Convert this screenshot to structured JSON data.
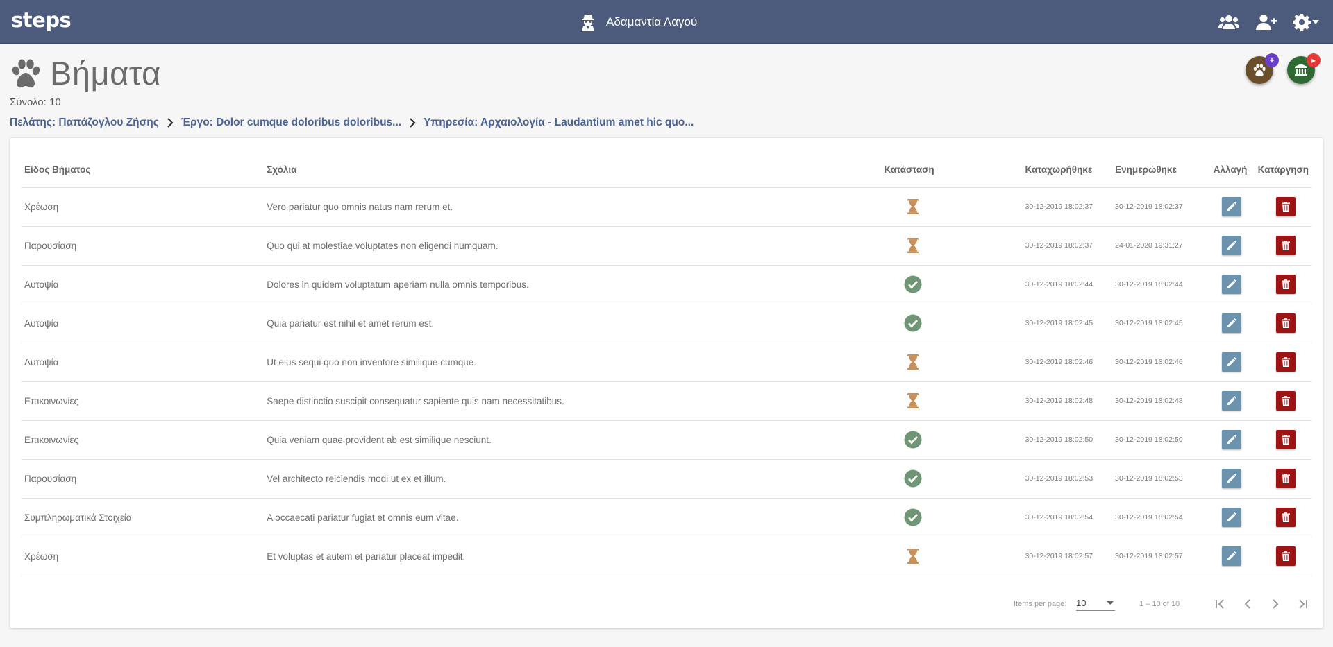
{
  "app": {
    "brand": "steps"
  },
  "header": {
    "user_name": "Αδαμαντία Λαγού",
    "icons": [
      "users-icon",
      "add-user-icon",
      "gear-icon"
    ]
  },
  "page": {
    "title": "Βήματα",
    "total_label": "Σύνολο: 10"
  },
  "breadcrumb": {
    "client": "Πελάτης: Παπάζογλου Ζήσης",
    "project": "Έργο: Dolor cumque doloribus doloribus...",
    "service": "Υπηρεσία: Αρχαιολογία - Laudantium amet hic quo..."
  },
  "fabs": {
    "steps_badge": "+",
    "service_badge": "▸"
  },
  "table": {
    "headers": {
      "type": "Είδος Βήματος",
      "comments": "Σχόλια",
      "status": "Κατάσταση",
      "created": "Καταχωρήθηκε",
      "updated": "Ενημερώθηκε",
      "edit": "Αλλαγή",
      "delete": "Κατάργηση"
    },
    "rows": [
      {
        "type": "Χρέωση",
        "comments": "Vero pariatur quo omnis natus nam rerum et.",
        "status": "pending",
        "created": "30-12-2019 18:02:37",
        "updated": "30-12-2019 18:02:37"
      },
      {
        "type": "Παρουσίαση",
        "comments": "Quo qui at molestiae voluptates non eligendi numquam.",
        "status": "pending",
        "created": "30-12-2019 18:02:37",
        "updated": "24-01-2020 19:31:27"
      },
      {
        "type": "Αυτοψία",
        "comments": "Dolores in quidem voluptatum aperiam nulla omnis temporibus.",
        "status": "done",
        "created": "30-12-2019 18:02:44",
        "updated": "30-12-2019 18:02:44"
      },
      {
        "type": "Αυτοψία",
        "comments": "Quia pariatur est nihil et amet rerum est.",
        "status": "done",
        "created": "30-12-2019 18:02:45",
        "updated": "30-12-2019 18:02:45"
      },
      {
        "type": "Αυτοψία",
        "comments": "Ut eius sequi quo non inventore similique cumque.",
        "status": "pending",
        "created": "30-12-2019 18:02:46",
        "updated": "30-12-2019 18:02:46"
      },
      {
        "type": "Επικοινωνίες",
        "comments": "Saepe distinctio suscipit consequatur sapiente quis nam necessitatibus.",
        "status": "pending",
        "created": "30-12-2019 18:02:48",
        "updated": "30-12-2019 18:02:48"
      },
      {
        "type": "Επικοινωνίες",
        "comments": "Quia veniam quae provident ab est similique nesciunt.",
        "status": "done",
        "created": "30-12-2019 18:02:50",
        "updated": "30-12-2019 18:02:50"
      },
      {
        "type": "Παρουσίαση",
        "comments": "Vel architecto reiciendis modi ut ex et illum.",
        "status": "done",
        "created": "30-12-2019 18:02:53",
        "updated": "30-12-2019 18:02:53"
      },
      {
        "type": "Συμπληρωματικά Στοιχεία",
        "comments": "A occaecati pariatur fugiat et omnis eum vitae.",
        "status": "done",
        "created": "30-12-2019 18:02:54",
        "updated": "30-12-2019 18:02:54"
      },
      {
        "type": "Χρέωση",
        "comments": "Et voluptas et autem et pariatur placeat impedit.",
        "status": "pending",
        "created": "30-12-2019 18:02:57",
        "updated": "30-12-2019 18:02:57"
      }
    ]
  },
  "paginator": {
    "items_per_page_label": "Items per page:",
    "page_size": "10",
    "range_label": "1 – 10 of 10"
  },
  "colors": {
    "header_bg": "#4c5b7c",
    "link": "#4b6396",
    "pending": "#c8905a",
    "done": "#6f9574",
    "edit_button": "#6c93ad",
    "delete_button": "#9c1414"
  }
}
